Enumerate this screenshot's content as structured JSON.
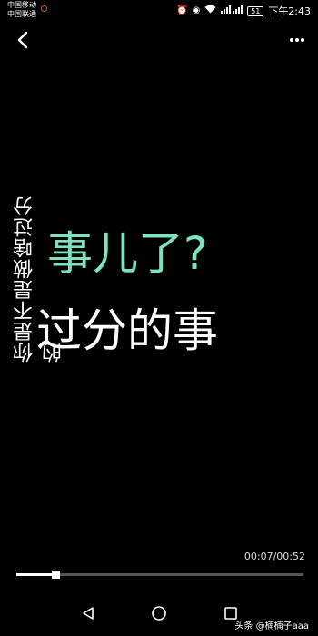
{
  "status_bar": {
    "carrier_1": "中国移动",
    "carrier_2": "中国联通",
    "battery": "51",
    "time": "下午2:43",
    "icons": [
      "alarm-icon",
      "eye-icon",
      "wifi-icon",
      "signal-icon",
      "battery-icon"
    ]
  },
  "header": {
    "back_icon": "chevron-left-icon",
    "more_icon": "more-dots-icon"
  },
  "video": {
    "vertical_caption": "你是不是做啥过分的",
    "caption_green": "事儿了?",
    "caption_white": "过分的事",
    "current_time": "00:07",
    "duration": "00:52",
    "time_label": "00:07/00:52",
    "progress": 0.135,
    "accent_color": "#7de3bf"
  },
  "nav_bar": {
    "icons": [
      "back-triangle-icon",
      "home-circle-icon",
      "recents-square-icon"
    ]
  },
  "watermark": {
    "text": "头条 @楠楠子aaa"
  }
}
